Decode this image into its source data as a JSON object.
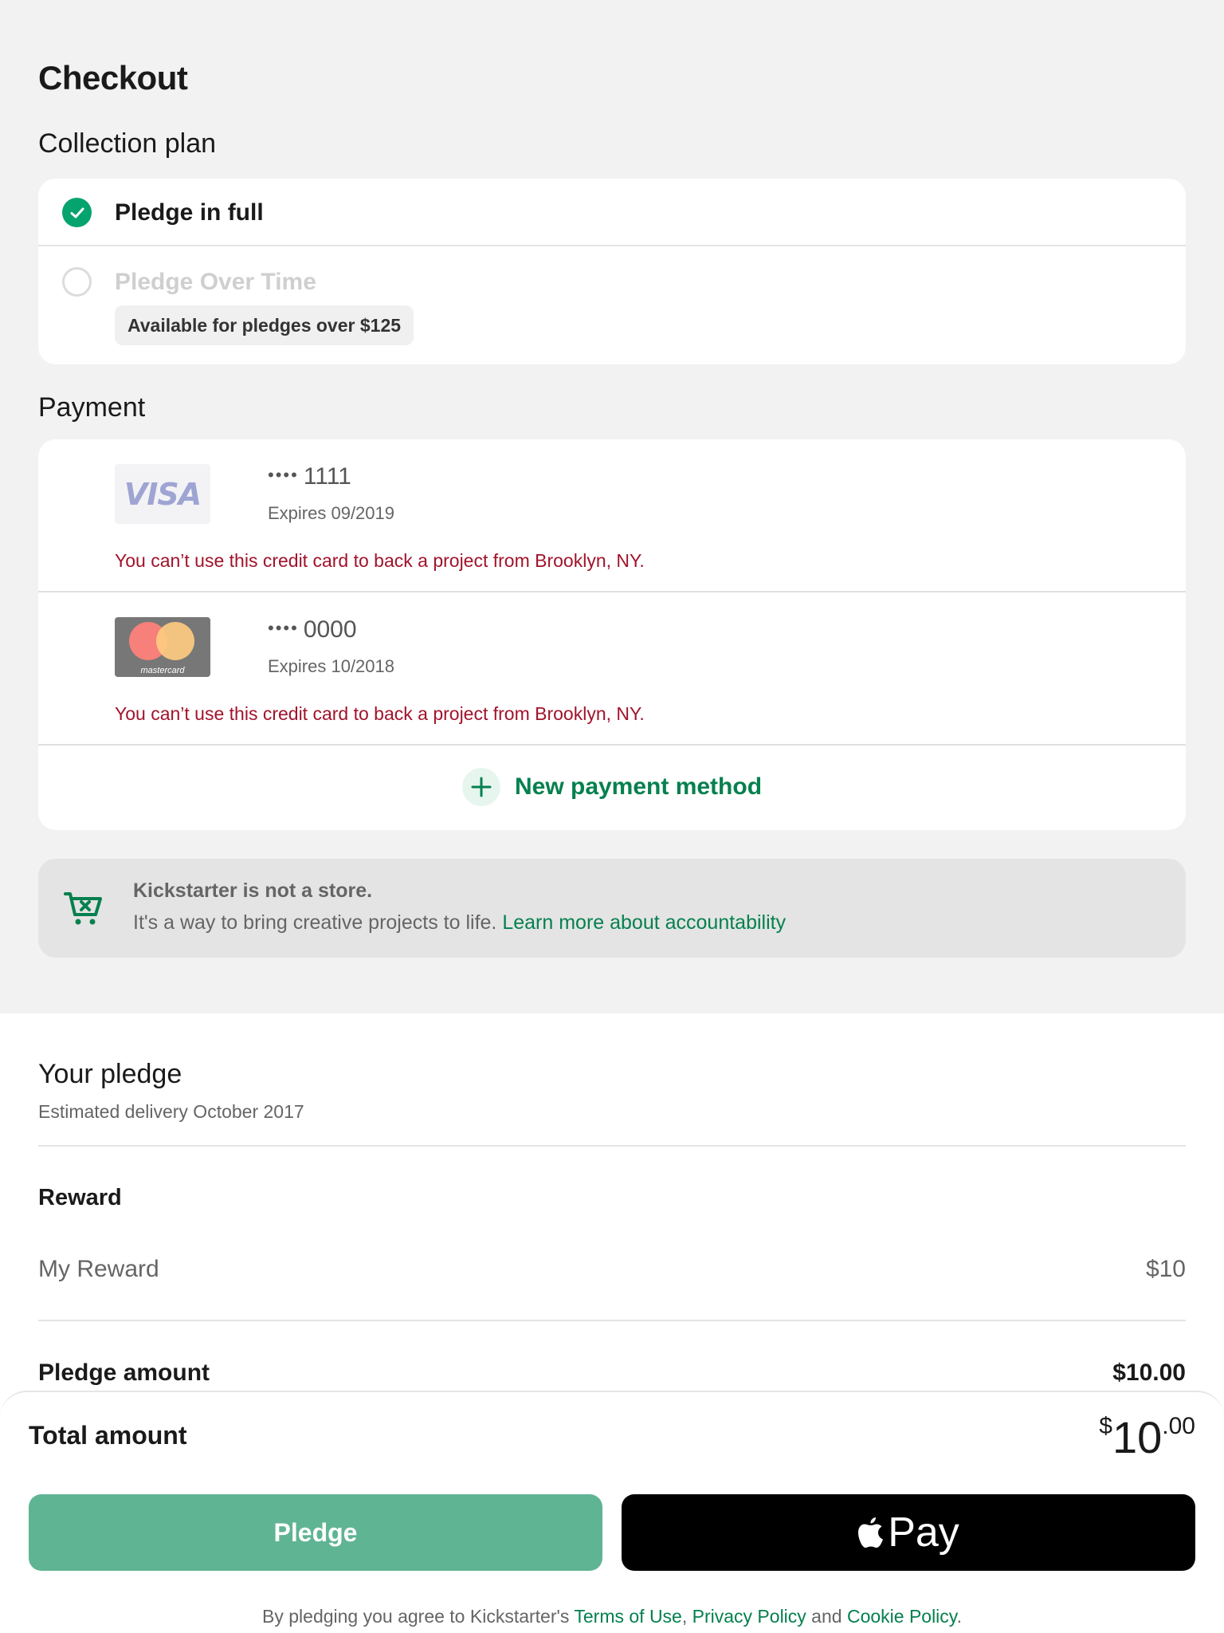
{
  "page_title": "Checkout",
  "collection_plan": {
    "title": "Collection plan",
    "options": [
      {
        "label": "Pledge in full",
        "selected": true
      },
      {
        "label": "Pledge Over Time",
        "selected": false,
        "badge": "Available for pledges over $125"
      }
    ]
  },
  "payment": {
    "title": "Payment",
    "cards": [
      {
        "brand": "VISA",
        "dots": "••••",
        "last4": "1111",
        "expires": "Expires 09/2019",
        "error": "You can’t use this credit card to back a project from Brooklyn, NY."
      },
      {
        "brand": "mastercard",
        "dots": "••••",
        "last4": "0000",
        "expires": "Expires 10/2018",
        "error": "You can’t use this credit card to back a project from Brooklyn, NY."
      }
    ],
    "new_method_label": "New payment method"
  },
  "notice": {
    "title": "Kickstarter is not a store.",
    "body": "It's a way to bring creative projects to life.",
    "link": "Learn more about accountability"
  },
  "your_pledge": {
    "title": "Your pledge",
    "delivery": "Estimated delivery October 2017",
    "reward_heading": "Reward",
    "reward_name": "My Reward",
    "reward_price": "$10",
    "pledge_amount_label": "Pledge amount",
    "pledge_amount_value": "$10.00"
  },
  "footer": {
    "total_label": "Total amount",
    "total_currency": "$",
    "total_whole": "10",
    "total_cents": ".00",
    "pledge_button": "Pledge",
    "apple_pay_label": "Pay",
    "legal_prefix": "By pledging you agree to Kickstarter's ",
    "terms": "Terms of Use",
    "comma": ", ",
    "privacy": "Privacy Policy",
    "and": " and ",
    "cookie": "Cookie Policy",
    "period": "."
  },
  "colors": {
    "accent": "#05a36e",
    "link": "#05804f",
    "error": "#a1132b",
    "pledge_button": "#5fb494"
  }
}
